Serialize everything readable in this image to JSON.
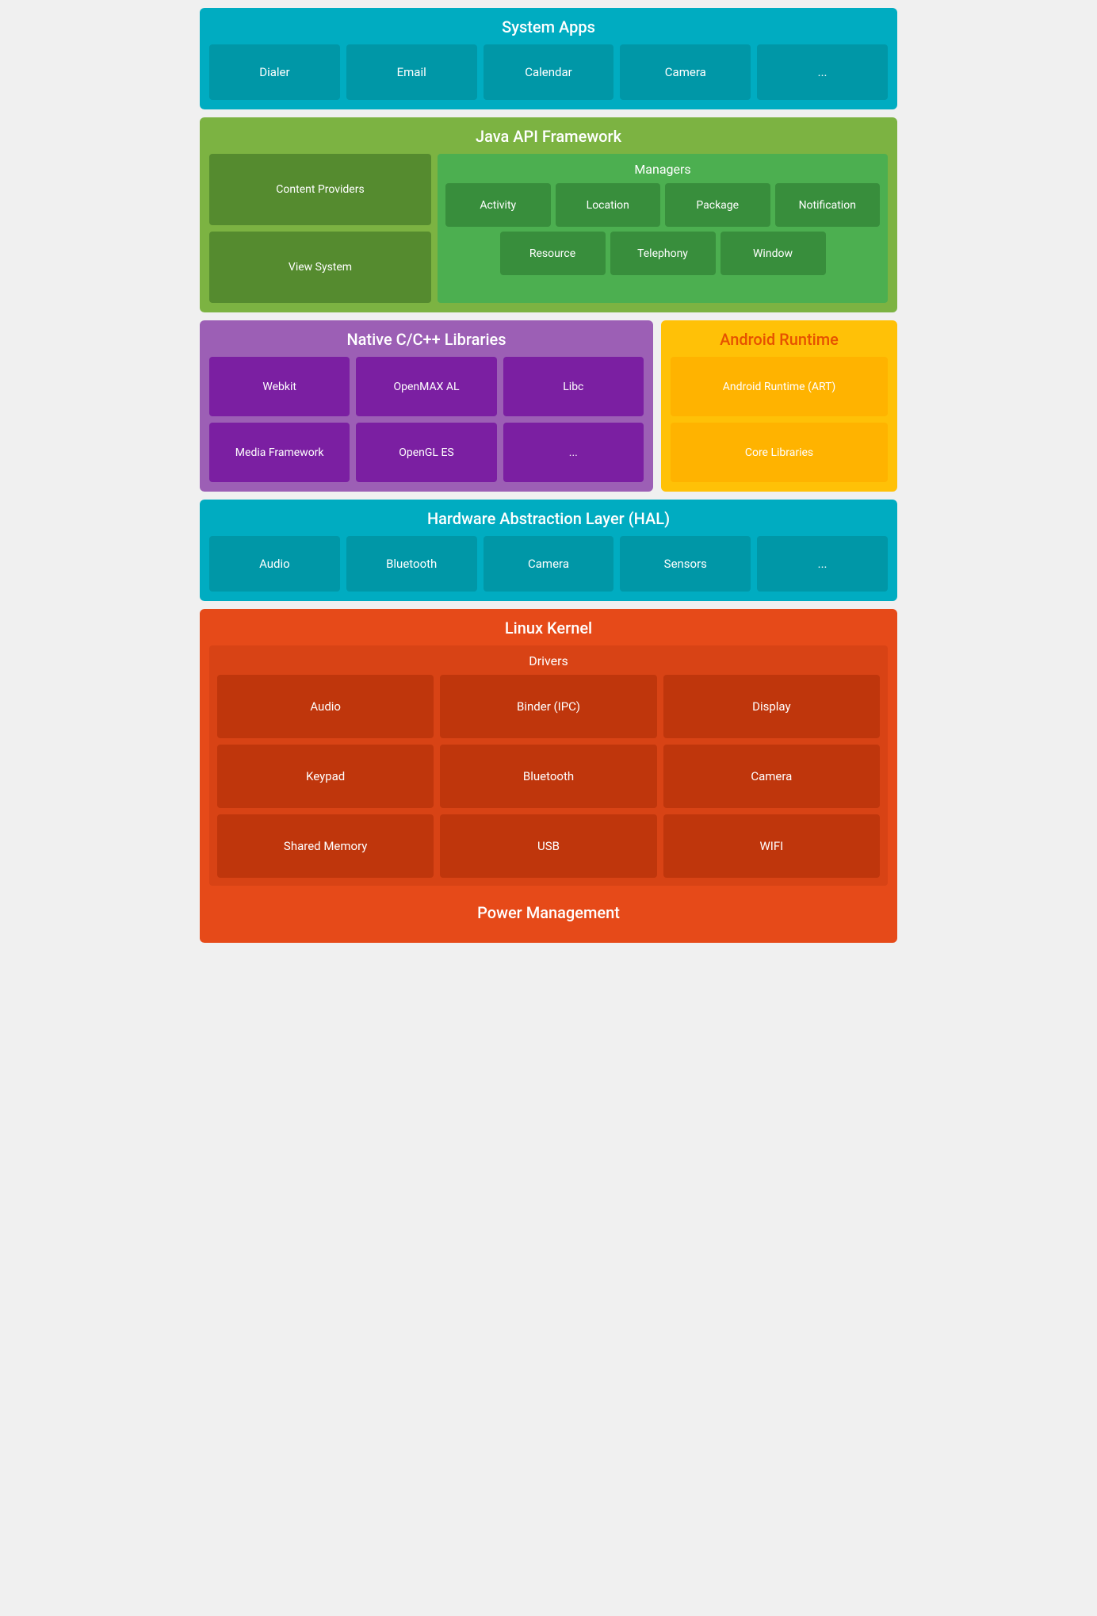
{
  "systemApps": {
    "title": "System Apps",
    "items": [
      "Dialer",
      "Email",
      "Calendar",
      "Camera",
      "..."
    ]
  },
  "javaApi": {
    "title": "Java API Framework",
    "leftItems": [
      "Content Providers",
      "View System"
    ],
    "managers": {
      "title": "Managers",
      "row1": [
        "Activity",
        "Location",
        "Package",
        "Notification"
      ],
      "row2": [
        "Resource",
        "Telephony",
        "Window"
      ]
    }
  },
  "nativeLibs": {
    "title": "Native C/C++ Libraries",
    "items": [
      "Webkit",
      "OpenMAX AL",
      "Libc",
      "Media Framework",
      "OpenGL ES",
      "..."
    ]
  },
  "androidRuntime": {
    "title": "Android Runtime",
    "items": [
      "Android Runtime (ART)",
      "Core Libraries"
    ]
  },
  "hal": {
    "title": "Hardware Abstraction Layer (HAL)",
    "items": [
      "Audio",
      "Bluetooth",
      "Camera",
      "Sensors",
      "..."
    ]
  },
  "linuxKernel": {
    "title": "Linux Kernel",
    "drivers": {
      "title": "Drivers",
      "items": [
        "Audio",
        "Binder (IPC)",
        "Display",
        "Keypad",
        "Bluetooth",
        "Camera",
        "Shared Memory",
        "USB",
        "WIFI"
      ]
    },
    "powerManagement": "Power Management"
  }
}
